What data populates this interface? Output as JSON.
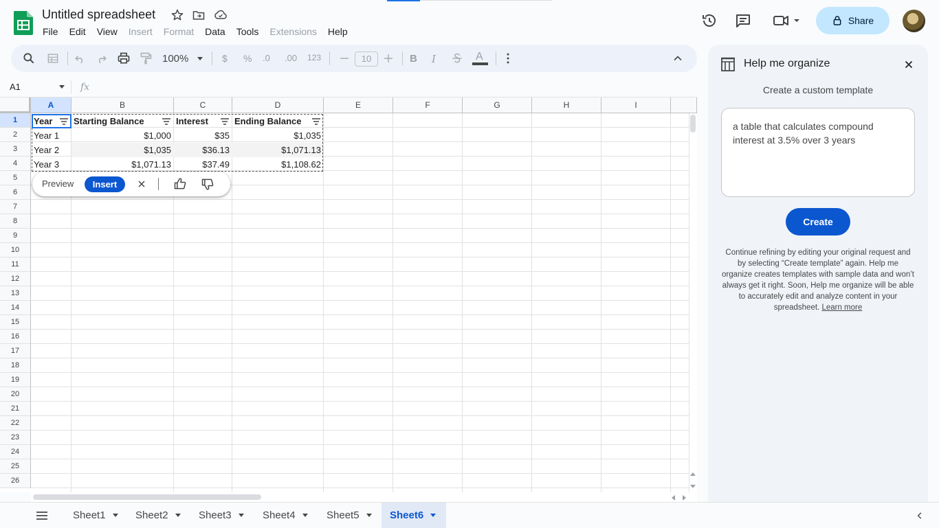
{
  "app": {
    "title": "Untitled spreadsheet",
    "share_label": "Share",
    "menu": [
      "File",
      "Edit",
      "View",
      "Insert",
      "Format",
      "Data",
      "Tools",
      "Extensions",
      "Help"
    ]
  },
  "toolbar": {
    "zoom": "100%",
    "currency": "$",
    "percent": "%",
    "dec_decrease": ".0",
    "dec_increase": ".00",
    "format_123": "123",
    "font_size": "10",
    "bold": "B",
    "italic": "I",
    "text_color": "A"
  },
  "formula_bar": {
    "name_box": "A1",
    "fx": "fx"
  },
  "grid": {
    "columns": [
      "A",
      "B",
      "C",
      "D",
      "E",
      "F",
      "G",
      "H",
      "I"
    ],
    "rows": [
      "1",
      "2",
      "3",
      "4",
      "5",
      "6",
      "7",
      "8",
      "9",
      "10",
      "11",
      "12",
      "13",
      "14",
      "15",
      "16",
      "17",
      "18",
      "19",
      "20",
      "21",
      "22",
      "23",
      "24",
      "25",
      "26"
    ],
    "header": [
      "Year",
      "Starting Balance",
      "Interest",
      "Ending Balance"
    ],
    "data": [
      [
        "Year 1",
        "$1,000",
        "$35",
        "$1,035"
      ],
      [
        "Year 2",
        "$1,035",
        "$36.13",
        "$1,071.13"
      ],
      [
        "Year 3",
        "$1,071.13",
        "$37.49",
        "$1,108.62"
      ]
    ]
  },
  "insert_bar": {
    "preview_label": "Preview",
    "insert_label": "Insert"
  },
  "sheets": [
    "Sheet1",
    "Sheet2",
    "Sheet3",
    "Sheet4",
    "Sheet5",
    "Sheet6"
  ],
  "active_sheet": "Sheet6",
  "panel": {
    "title": "Help me organize",
    "subtitle": "Create a custom template",
    "prompt": "a table that calculates compound interest at 3.5% over 3 years",
    "create_label": "Create",
    "help_text": "Continue refining by editing your original request and by selecting “Create template” again. Help me organize creates templates with sample data and won’t always get it right. Soon, Help me organize will be able to accurately edit and analyze content in your spreadsheet.",
    "learn_more": "Learn more"
  },
  "colors": {
    "accent": "#0b57d0",
    "share_bg": "#c2e7ff",
    "sheets_green": "#0f9d58"
  }
}
